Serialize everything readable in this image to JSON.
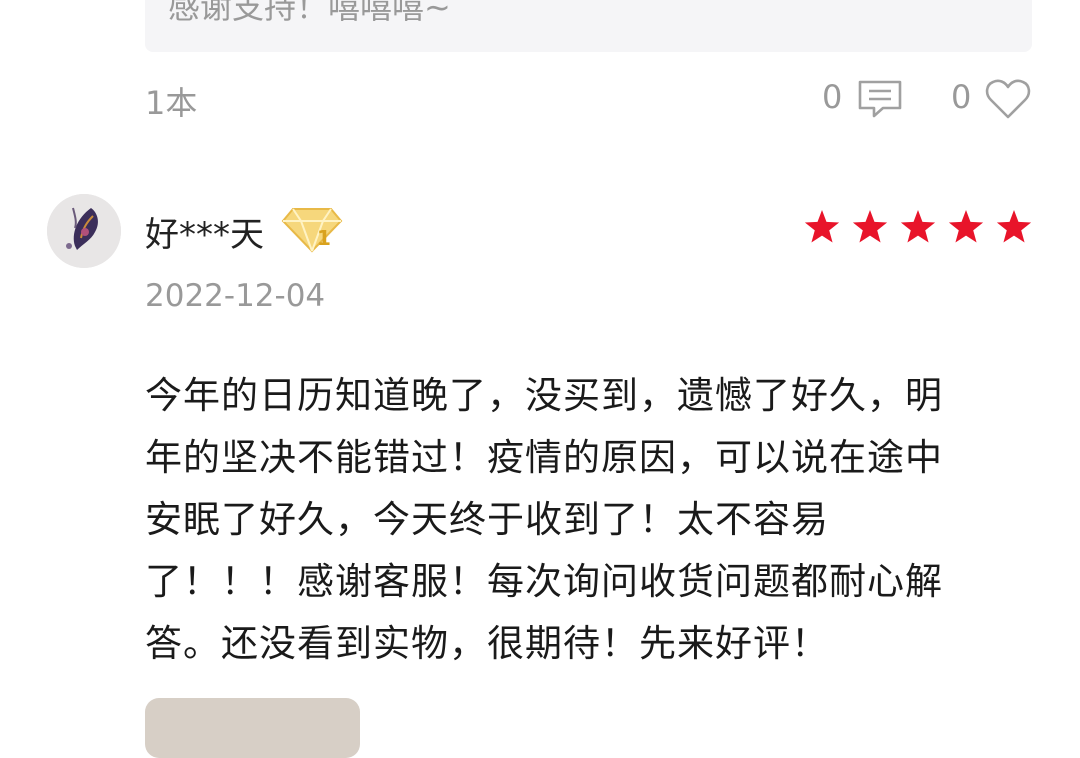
{
  "previous_review": {
    "reply_text": "感谢支持！嘻嘻嘻~",
    "volume": "1本",
    "comment_count": "0",
    "like_count": "0"
  },
  "review": {
    "username": "好***天",
    "vip_level": "1",
    "rating": 5,
    "date": "2022-12-04",
    "text_lines": [
      "今年的日历知道晚了，没买到，遗憾了好久，明",
      "年的坚决不能错过！疫情的原因，可以说在途中",
      "安眠了好久，今天终于收到了！太不容易",
      "了！！！感谢客服！每次询问收货问题都耐心解",
      "答。还没看到实物，很期待！先来好评！"
    ]
  },
  "colors": {
    "star": "#e8142a",
    "muted_text": "#999999",
    "vip_gold": "#f2c94c"
  },
  "icons": [
    "comment-icon",
    "heart-icon",
    "vip-badge-icon",
    "star-icon"
  ]
}
